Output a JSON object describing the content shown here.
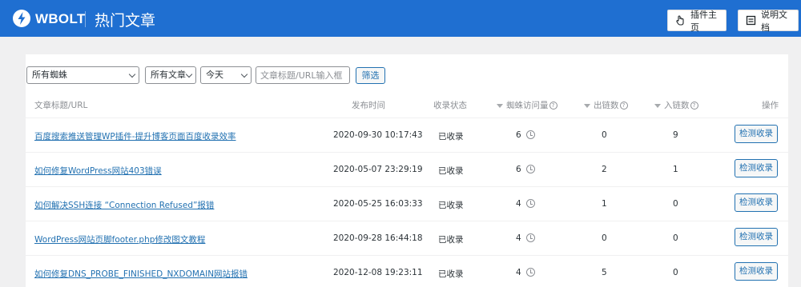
{
  "header": {
    "brand": "WBOLT",
    "title": "热门文章",
    "plugin_home_label": "插件主页",
    "docs_label": "说明文档",
    "accent_color": "#1f6fd1"
  },
  "filters": {
    "spider_select": "所有蜘蛛",
    "posts_select": "所有文章",
    "period_select": "今天",
    "search_placeholder": "文章标题/URL输入框",
    "filter_button": "筛选"
  },
  "table": {
    "columns": {
      "title": "文章标题/URL",
      "date": "发布时间",
      "status": "收录状态",
      "visits": "蜘蛛访问量",
      "out_links": "出链数",
      "in_links": "入链数",
      "action": "操作"
    },
    "rows": [
      {
        "title": "百度搜索推送管理WP插件-提升博客页面百度收录效率",
        "date": "2020-09-30 10:17:43",
        "status": "已收录",
        "visits": "6",
        "out_links": "0",
        "in_links": "9",
        "action": "检测收录"
      },
      {
        "title": "如何修复WordPress网站403错误",
        "date": "2020-05-07 23:29:19",
        "status": "已收录",
        "visits": "6",
        "out_links": "2",
        "in_links": "1",
        "action": "检测收录"
      },
      {
        "title": "如何解决SSH连接 “Connection Refused”报错",
        "date": "2020-05-25 16:03:33",
        "status": "已收录",
        "visits": "4",
        "out_links": "1",
        "in_links": "0",
        "action": "检测收录"
      },
      {
        "title": "WordPress网站页脚footer.php修改图文教程",
        "date": "2020-09-28 16:44:18",
        "status": "已收录",
        "visits": "4",
        "out_links": "0",
        "in_links": "0",
        "action": "检测收录"
      },
      {
        "title": "如何修复DNS_PROBE_FINISHED_NXDOMAIN网站报错",
        "date": "2020-12-08 19:23:11",
        "status": "已收录",
        "visits": "4",
        "out_links": "5",
        "in_links": "0",
        "action": "检测收录"
      }
    ]
  }
}
